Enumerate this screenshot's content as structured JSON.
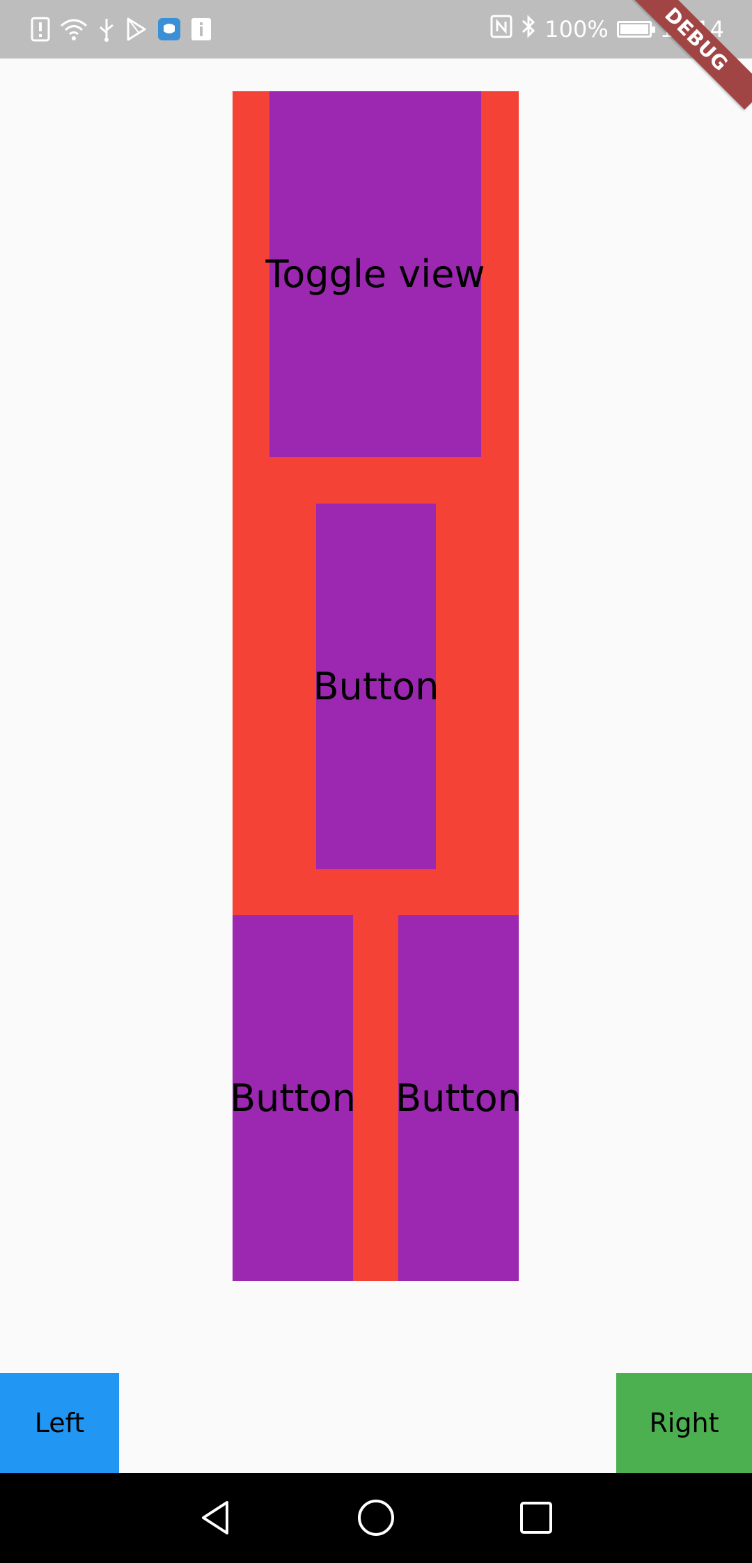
{
  "status_bar": {
    "battery": "100%",
    "time": "14:14",
    "left_icons": [
      "sim-alert-icon",
      "wifi-icon",
      "usb-icon",
      "play-store-icon",
      "app-notification-icon",
      "info-icon"
    ],
    "right_icons": [
      "nfc-icon",
      "bluetooth-icon",
      "battery-icon"
    ]
  },
  "debug_banner": "DEBUG",
  "layout": {
    "toggle_label": "Toggle view",
    "center_button_label": "Button",
    "bottom_left_button_label": "Button",
    "bottom_right_button_label": "Button"
  },
  "bottom_buttons": {
    "left_label": "Left",
    "right_label": "Right"
  },
  "nav_bar": {
    "icons": [
      "back-icon",
      "home-icon",
      "recents-icon"
    ]
  },
  "colors": {
    "container_red": "#f44336",
    "button_purple": "#9c27b0",
    "left_blue": "#2196f3",
    "right_green": "#4caf50",
    "status_bar_gray": "#bdbdbd",
    "debug_ribbon": "#a14444"
  }
}
